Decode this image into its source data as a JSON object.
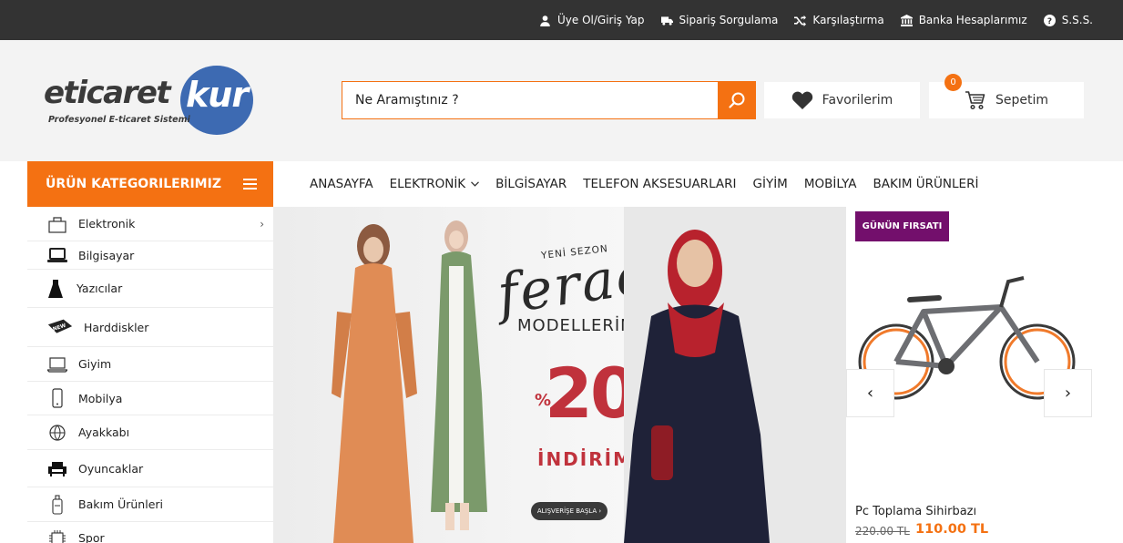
{
  "topbar": {
    "links": [
      {
        "label": "Üye Ol/Giriş Yap",
        "icon": "user-icon"
      },
      {
        "label": "Sipariş Sorgulama",
        "icon": "truck-icon"
      },
      {
        "label": "Karşılaştırma",
        "icon": "shuffle-icon"
      },
      {
        "label": "Banka Hesaplarımız",
        "icon": "bank-icon"
      },
      {
        "label": "S.S.S.",
        "icon": "question-icon"
      }
    ]
  },
  "header": {
    "logo": {
      "main": "eticaret",
      "accent": "kur",
      "tagline": "Profesyonel E-ticaret Sistemi"
    },
    "search": {
      "placeholder": "Ne Aramıştınız ?"
    },
    "favorites_label": "Favorilerim",
    "cart_label": "Sepetim",
    "cart_count": "0"
  },
  "nav": {
    "categories_title": "ÜRÜN KATEGORILERIMIZ",
    "menu": [
      "ANASAYFA",
      "ELEKTRONİK",
      "BİLGİSAYAR",
      "TELEFON AKSESUARLARI",
      "GİYİM",
      "MOBİLYA",
      "BAKIM ÜRÜNLERİ"
    ]
  },
  "sidebar": {
    "items": [
      {
        "label": "Elektronik",
        "icon": "bag-icon",
        "has_sub": true
      },
      {
        "label": "Bilgisayar",
        "icon": "laptop-icon",
        "has_sub": false
      },
      {
        "label": "Yazıcılar",
        "icon": "dress-icon",
        "has_sub": false
      },
      {
        "label": "Harddiskler",
        "icon": "new-tag-icon",
        "has_sub": false
      },
      {
        "label": "Giyim",
        "icon": "laptop-outline-icon",
        "has_sub": false
      },
      {
        "label": "Mobilya",
        "icon": "phone-icon",
        "has_sub": false
      },
      {
        "label": "Ayakkabı",
        "icon": "ball-icon",
        "has_sub": false
      },
      {
        "label": "Oyuncaklar",
        "icon": "armchair-icon",
        "has_sub": false
      },
      {
        "label": "Bakım Ürünleri",
        "icon": "bottle-icon",
        "has_sub": false
      },
      {
        "label": "Spor",
        "icon": "chip-icon",
        "has_sub": false
      }
    ]
  },
  "banner": {
    "small": "YENİ SEZON",
    "script": "ferace",
    "models": "MODELLERİNDE",
    "percent_sign": "%",
    "percent": "20",
    "discount": "İNDİRİM",
    "button": "ALIŞVERİŞE BAŞLA ›"
  },
  "deal": {
    "badge": "GÜNÜN FIRSATI",
    "name": "Pc Toplama Sihirbazı",
    "old_price": "220.00 TL",
    "new_price": "110.00 TL",
    "prev": "‹",
    "next": "›"
  },
  "colors": {
    "accent": "#f47112",
    "topbar": "#333333",
    "deal_badge": "#730f6c",
    "logo_blue": "#3d6ab2",
    "banner_red": "#c0323c"
  }
}
